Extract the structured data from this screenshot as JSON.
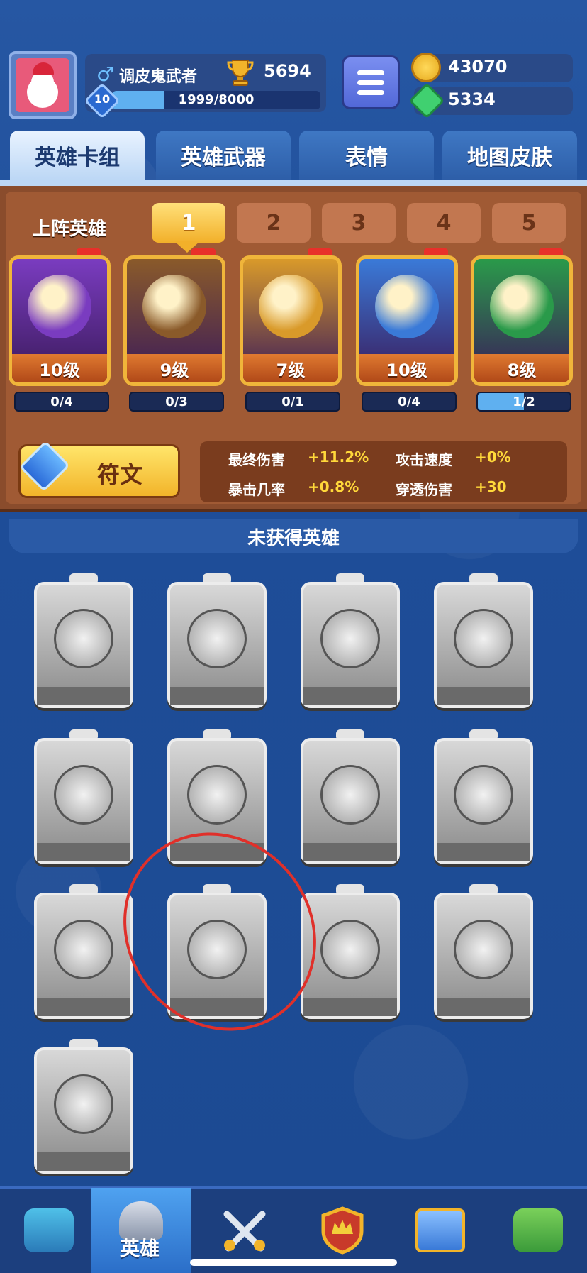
{
  "player": {
    "name": "调皮鬼武者",
    "gender_icon": "♂",
    "trophies": "5694",
    "level": "10",
    "xp_text": "1999/8000",
    "xp_fraction": 0.25
  },
  "currency": {
    "coins": "43070",
    "gems": "5334"
  },
  "tabs": [
    {
      "label": "英雄卡组",
      "active": true
    },
    {
      "label": "英雄武器",
      "active": false
    },
    {
      "label": "表情",
      "active": false
    },
    {
      "label": "地图皮肤",
      "active": false
    }
  ],
  "lineup": {
    "label": "上阵英雄",
    "decks": [
      "1",
      "2",
      "3",
      "4",
      "5"
    ],
    "active_deck": "1"
  },
  "heroes": [
    {
      "level": "10级",
      "progress": "0/4",
      "fraction": 0.0,
      "color": "#7a3cc0"
    },
    {
      "level": "9级",
      "progress": "0/3",
      "fraction": 0.0,
      "color": "#8a5a2a"
    },
    {
      "level": "7级",
      "progress": "0/1",
      "fraction": 0.0,
      "color": "#d99a2a"
    },
    {
      "level": "10级",
      "progress": "0/4",
      "fraction": 0.0,
      "color": "#3a7ad8"
    },
    {
      "level": "8级",
      "progress": "1/2",
      "fraction": 0.5,
      "color": "#2a9a4a"
    }
  ],
  "rune": {
    "label": "符文"
  },
  "stats": [
    {
      "label": "最终伤害",
      "value": "+11.2%"
    },
    {
      "label": "攻击速度",
      "value": "+0%"
    },
    {
      "label": "暴击几率",
      "value": "+0.8%"
    },
    {
      "label": "穿透伤害",
      "value": "+30"
    }
  ],
  "locked": {
    "header": "未获得英雄",
    "count": 13
  },
  "bottom_nav": {
    "active_label": "英雄",
    "items": [
      "treasure-chest-icon",
      "knight-helmet-icon",
      "crossed-swords-icon",
      "crown-shield-icon",
      "friends-banner-icon",
      "sprout-island-icon"
    ]
  }
}
